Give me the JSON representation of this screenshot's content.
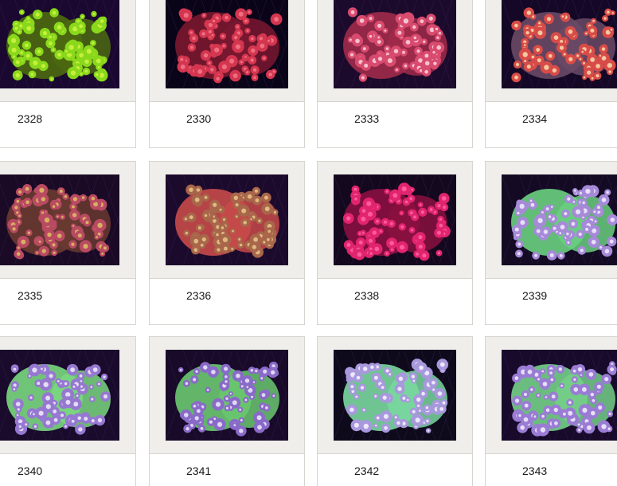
{
  "items": [
    {
      "id": "2328",
      "colors": [
        "#1a0830",
        "#8ad81c",
        "#c5f03a",
        "#4c6a10"
      ]
    },
    {
      "id": "2330",
      "colors": [
        "#0a0418",
        "#d4364f",
        "#f06e82",
        "#7a1830"
      ]
    },
    {
      "id": "2333",
      "colors": [
        "#1c0a2c",
        "#d84a6e",
        "#f5c2cf",
        "#a02a4a"
      ]
    },
    {
      "id": "2334",
      "colors": [
        "#140826",
        "#d84c48",
        "#f3c8a0",
        "#6a4a66"
      ]
    },
    {
      "id": "2335",
      "colors": [
        "#1a0a26",
        "#b84a62",
        "#d8b060",
        "#6a3a30"
      ]
    },
    {
      "id": "2336",
      "colors": [
        "#1c0a2c",
        "#a8664a",
        "#e0b880",
        "#c84a4a"
      ]
    },
    {
      "id": "2338",
      "colors": [
        "#14081e",
        "#e0246e",
        "#ff5a9c",
        "#8a1040"
      ]
    },
    {
      "id": "2339",
      "colors": [
        "#140a24",
        "#a68ad8",
        "#e8e0f8",
        "#6ad080"
      ]
    },
    {
      "id": "2340",
      "colors": [
        "#1a0a2c",
        "#9678d0",
        "#e4dcf6",
        "#7ad880"
      ]
    },
    {
      "id": "2341",
      "colors": [
        "#180a28",
        "#8a6ac8",
        "#e0d8f4",
        "#6ac870"
      ]
    },
    {
      "id": "2342",
      "colors": [
        "#0e0a1c",
        "#a898dc",
        "#ece8fa",
        "#7ad8a0"
      ]
    },
    {
      "id": "2343",
      "colors": [
        "#180a2a",
        "#9a7cd4",
        "#e8dff8",
        "#74d088"
      ]
    }
  ]
}
